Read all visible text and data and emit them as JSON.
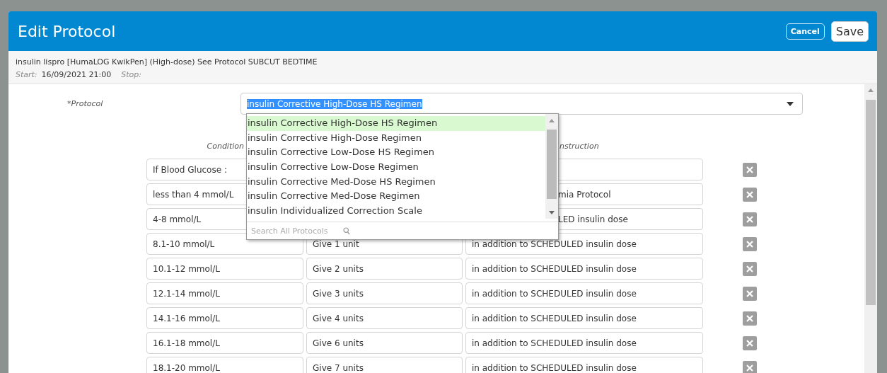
{
  "dialog": {
    "title": "Edit Protocol",
    "buttons": [
      {
        "label": "Cancel",
        "kind": "secondary"
      },
      {
        "label": "Save",
        "kind": "primary"
      }
    ]
  },
  "order": {
    "description": "insulin lispro [HumaLOG KwikPen] (High-dose) See Protocol SUBCUT BEDTIME",
    "start_label": "Start:",
    "start_value": "16/09/2021 21:00",
    "stop_label": "Stop:"
  },
  "protocol": {
    "label": "*Protocol",
    "value": "insulin Corrective High-Dose HS Regimen",
    "value_selected": true
  },
  "dropdown": {
    "open": true,
    "search_placeholder": "Search All Protocols",
    "options": [
      {
        "label": "insulin Corrective High-Dose HS Regimen",
        "selected": true
      },
      {
        "label": "insulin Corrective High-Dose Regimen",
        "selected": false
      },
      {
        "label": "insulin Corrective Low-Dose HS Regimen",
        "selected": false
      },
      {
        "label": "insulin Corrective Low-Dose Regimen",
        "selected": false
      },
      {
        "label": "insulin Corrective Med-Dose HS Regimen",
        "selected": false
      },
      {
        "label": "insulin Corrective Med-Dose Regimen",
        "selected": false
      },
      {
        "label": "insulin Individualized Correction Scale",
        "selected": false
      }
    ]
  },
  "columns": {
    "condition": "Condition",
    "instruction": "nstruction"
  },
  "rows": [
    {
      "condition": "If Blood Glucose :"
    },
    {
      "condition": "less than 4 mmol/L",
      "instruction": "mia Protocol",
      "covered": true
    },
    {
      "condition": "4-8 mmol/L",
      "instruction": "LED insulin dose",
      "covered": true
    },
    {
      "condition": "8.1-10 mmol/L",
      "dose": "Give 1 unit",
      "instruction": "in addition to SCHEDULED insulin dose",
      "covered": false
    },
    {
      "condition": "10.1-12 mmol/L",
      "dose": "Give 2 units",
      "instruction": "in addition to SCHEDULED insulin dose",
      "covered": false
    },
    {
      "condition": "12.1-14 mmol/L",
      "dose": "Give 3 units",
      "instruction": "in addition to SCHEDULED insulin dose",
      "covered": false
    },
    {
      "condition": "14.1-16 mmol/L",
      "dose": "Give 4 units",
      "instruction": "in addition to SCHEDULED insulin dose",
      "covered": false
    },
    {
      "condition": "16.1-18 mmol/L",
      "dose": "Give 6 units",
      "instruction": "in addition to SCHEDULED insulin dose",
      "covered": false
    },
    {
      "condition": "18.1-20 mmol/L",
      "dose": "Give 7 units",
      "instruction": "in addition to SCHEDULED insulin dose",
      "covered": false
    }
  ]
}
